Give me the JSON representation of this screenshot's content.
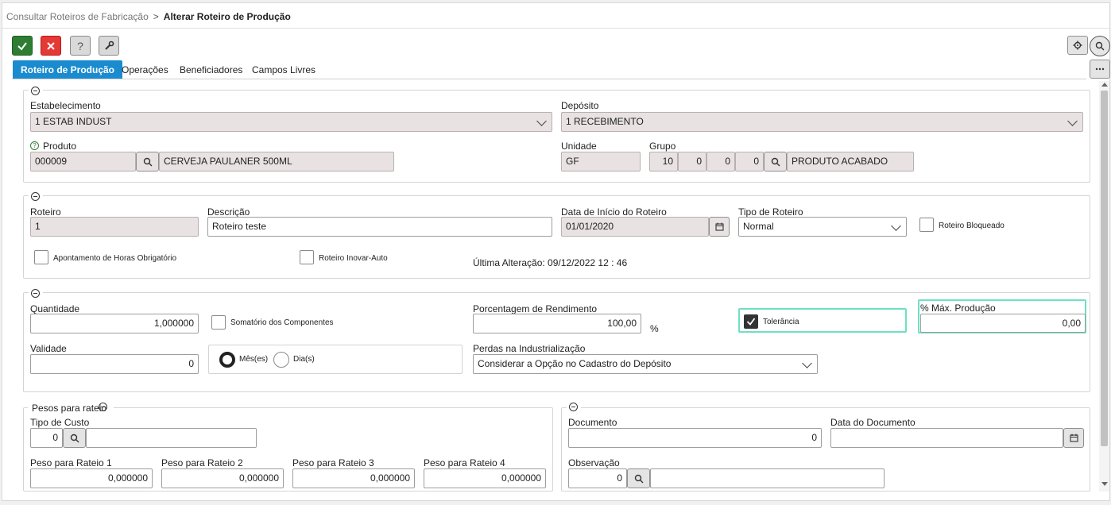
{
  "breadcrumb": {
    "parent": "Consultar Roteiros de Fabricação",
    "separator": ">",
    "current": "Alterar Roteiro de Produção"
  },
  "toolbar": {
    "confirm_icon": "check-icon",
    "cancel_icon": "close-icon",
    "help_icon": "question-icon",
    "tools_icon": "wrench-icon",
    "help_glyph": "?"
  },
  "tabs": [
    {
      "label": "Roteiro de Produção",
      "active": true
    },
    {
      "label": "Operações",
      "active": false
    },
    {
      "label": "Beneficiadores",
      "active": false
    },
    {
      "label": "Campos Livres",
      "active": false
    }
  ],
  "section1": {
    "estabelecimento_label": "Estabelecimento",
    "estabelecimento_value": "1 ESTAB INDUST",
    "deposito_label": "Depósito",
    "deposito_value": "1 RECEBIMENTO",
    "produto_label": "Produto",
    "produto_code": "000009",
    "produto_desc": "CERVEJA PAULANER 500ML",
    "unidade_label": "Unidade",
    "unidade_value": "GF",
    "grupo_label": "Grupo",
    "grupo_values": [
      "10",
      "0",
      "0",
      "0"
    ],
    "grupo_desc": "PRODUTO ACABADO"
  },
  "section2": {
    "roteiro_label": "Roteiro",
    "roteiro_value": "1",
    "descricao_label": "Descrição",
    "descricao_value": "Roteiro teste",
    "data_inicio_label": "Data de Início do Roteiro",
    "data_inicio_value": "01/01/2020",
    "tipo_label": "Tipo de Roteiro",
    "tipo_value": "Normal",
    "bloqueado_label": "Roteiro Bloqueado",
    "apontamento_label": "Apontamento de Horas Obrigatório",
    "inovar_label": "Roteiro Inovar-Auto",
    "ultima_alteracao": "Última Alteração: 09/12/2022 12 : 46"
  },
  "section3": {
    "quantidade_label": "Quantidade",
    "quantidade_value": "1,000000",
    "somatorio_label": "Somatório dos Componentes",
    "rendimento_label": "Porcentagem de Rendimento",
    "rendimento_value": "100,00",
    "rendimento_unit": "%",
    "tolerancia_label": "Tolerância",
    "tolerancia_checked": true,
    "max_producao_label": "% Máx. Produção",
    "max_producao_value": "0,00",
    "validade_label": "Validade",
    "validade_value": "0",
    "meses_label": "Mês(es)",
    "dias_label": "Dia(s)",
    "perdas_label": "Perdas na Industrialização",
    "perdas_value": "Considerar a Opção no Cadastro do Depósito"
  },
  "section4": {
    "legend": "Pesos para rateio",
    "tipo_custo_label": "Tipo de Custo",
    "tipo_custo_value": "0",
    "pesos": [
      {
        "label": "Peso para Rateio 1",
        "value": "0,000000"
      },
      {
        "label": "Peso para Rateio 2",
        "value": "0,000000"
      },
      {
        "label": "Peso para Rateio 3",
        "value": "0,000000"
      },
      {
        "label": "Peso para Rateio 4",
        "value": "0,000000"
      }
    ]
  },
  "section5": {
    "documento_label": "Documento",
    "documento_value": "0",
    "data_documento_label": "Data do Documento",
    "observacao_label": "Observação",
    "observacao_value": "0"
  },
  "colors": {
    "tab_active": "#1b8bd0",
    "confirm": "#2e7d32",
    "cancel": "#e53935",
    "readonly_bg": "#e9e2e2",
    "highlight": "#6ee0c0"
  }
}
